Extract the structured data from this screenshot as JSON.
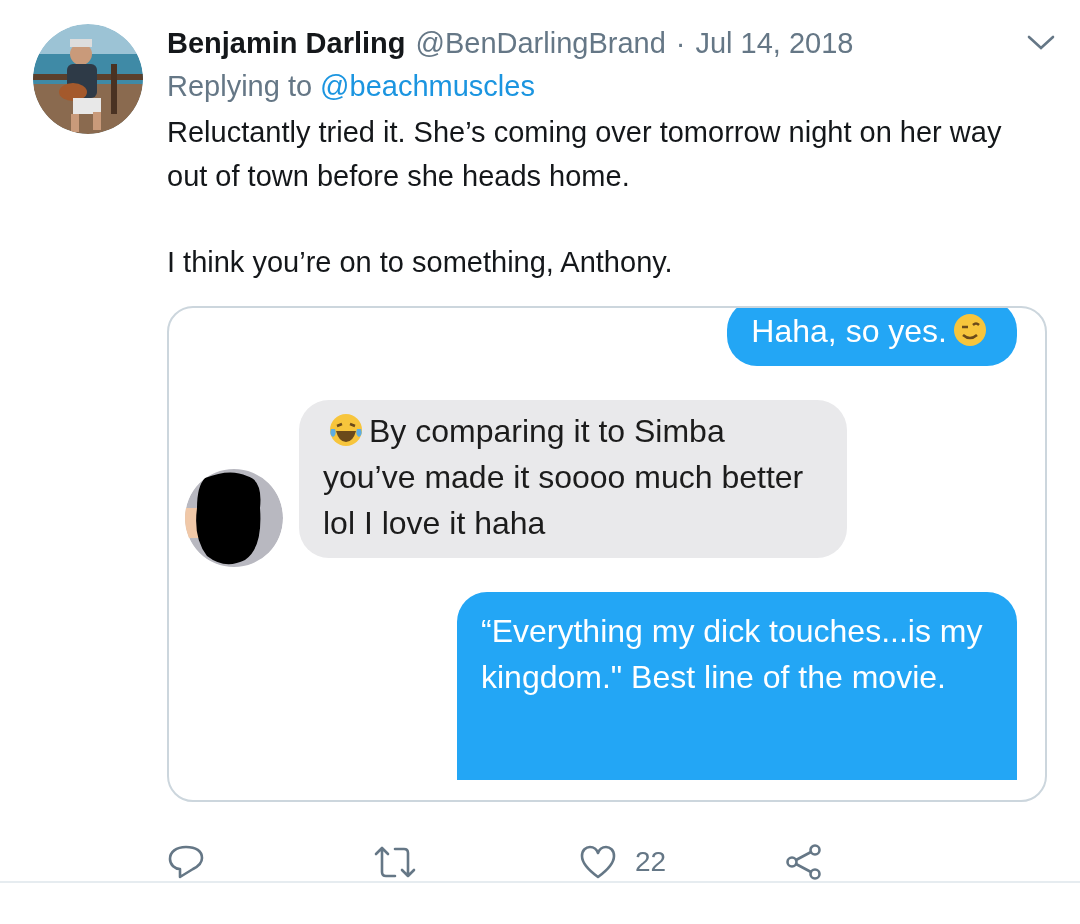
{
  "tweet": {
    "author": {
      "name": "Benjamin Darling",
      "handle": "@BenDarlingBrand",
      "separator": "·",
      "date": "Jul 14, 2018"
    },
    "reply_to": {
      "label": "Replying to",
      "handle": "@beachmuscles"
    },
    "paragraphs": [
      "Reluctantly tried it. She’s coming over tomorrow night on her way out of town before she heads home.",
      "I think you’re on to something, Anthony."
    ],
    "media": {
      "messages": [
        {
          "kind": "sent",
          "text": "Haha, so yes.",
          "emoji": {
            "kind": "wink"
          }
        },
        {
          "kind": "received",
          "text": "By comparing it to Simba you’ve made it soooo much better lol I love it haha",
          "emoji": {
            "kind": "laugh"
          }
        },
        {
          "kind": "sent",
          "text": "“Everything my dick touches...is my kingdom.\"  Best line of the movie."
        }
      ]
    },
    "actions": [
      {
        "kind": "reply"
      },
      {
        "kind": "retweet"
      },
      {
        "kind": "like",
        "count": "22"
      },
      {
        "kind": "share"
      }
    ]
  }
}
